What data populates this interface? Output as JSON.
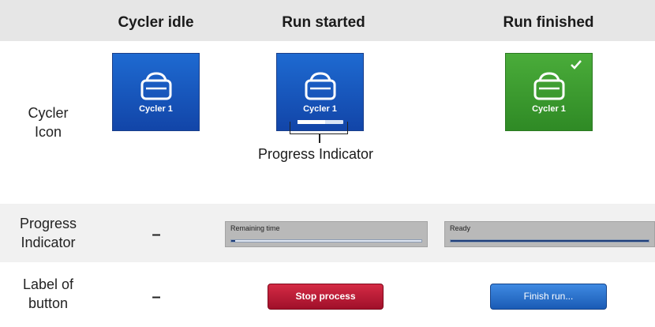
{
  "columns": {
    "idle": "Cycler idle",
    "started": "Run started",
    "finished": "Run finished"
  },
  "rows": {
    "cycler_icon": [
      "Cycler",
      "Icon"
    ],
    "progress_indicator": [
      "Progress",
      "Indicator"
    ],
    "label_of_button": [
      "Label of",
      "button"
    ]
  },
  "dash": "–",
  "icons": {
    "idle": {
      "name": "Cycler 1",
      "color": "blue",
      "glyph": "cycler-icon"
    },
    "started": {
      "name": "Cycler 1",
      "color": "blue",
      "glyph": "cycler-icon",
      "progress": 0.6
    },
    "finished": {
      "name": "Cycler 1",
      "color": "green",
      "glyph": "cycler-icon",
      "badge": "check-icon"
    }
  },
  "callout": "Progress Indicator",
  "progress_bars": {
    "started": {
      "text": "Remaining time",
      "progress": 0.02
    },
    "finished": {
      "text": "Ready",
      "progress": 1.0
    }
  },
  "buttons": {
    "started": {
      "label": "Stop process",
      "color": "#b5152f"
    },
    "finished": {
      "label": "Finish run...",
      "color": "#2b72cc"
    }
  },
  "colors": {
    "header_bg": "#e6e6e6",
    "icon_blue": "#1656bd",
    "icon_green": "#3c9a2f"
  }
}
